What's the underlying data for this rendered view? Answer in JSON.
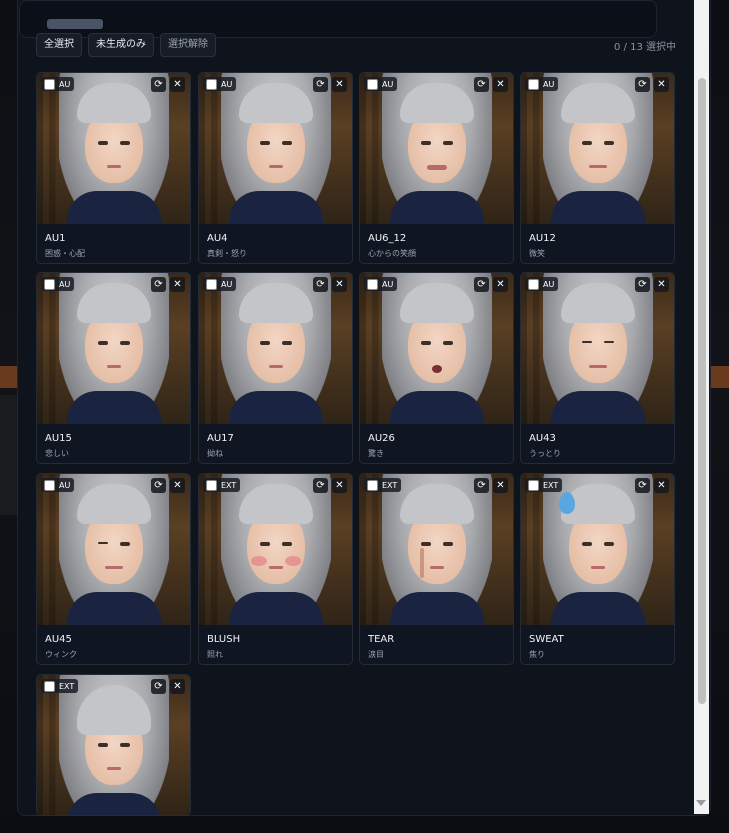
{
  "toolbar": {
    "select_all": "全選択",
    "ungenerated_only": "未生成のみ",
    "clear_selection": "選択解除",
    "selection_count": "0 / 13 選択中"
  },
  "icons": {
    "regenerate": "refresh-icon",
    "remove": "close-icon",
    "checkbox": "checkbox-icon"
  },
  "cards": [
    {
      "tag": "AU",
      "name": "AU1",
      "desc": "困惑・心配"
    },
    {
      "tag": "AU",
      "name": "AU4",
      "desc": "真剣・怒り"
    },
    {
      "tag": "AU",
      "name": "AU6_12",
      "desc": "心からの笑顔"
    },
    {
      "tag": "AU",
      "name": "AU12",
      "desc": "微笑"
    },
    {
      "tag": "AU",
      "name": "AU15",
      "desc": "悲しい"
    },
    {
      "tag": "AU",
      "name": "AU17",
      "desc": "拗ね"
    },
    {
      "tag": "AU",
      "name": "AU26",
      "desc": "驚き"
    },
    {
      "tag": "AU",
      "name": "AU43",
      "desc": "うっとり"
    },
    {
      "tag": "AU",
      "name": "AU45",
      "desc": "ウィンク"
    },
    {
      "tag": "EXT",
      "name": "BLUSH",
      "desc": "照れ"
    },
    {
      "tag": "EXT",
      "name": "TEAR",
      "desc": "涙目"
    },
    {
      "tag": "EXT",
      "name": "SWEAT",
      "desc": "焦り"
    },
    {
      "tag": "EXT",
      "name": "",
      "desc": ""
    }
  ],
  "colors": {
    "panel": "#0f131b",
    "card": "#101621",
    "accent_text": "#e6e9ef"
  }
}
